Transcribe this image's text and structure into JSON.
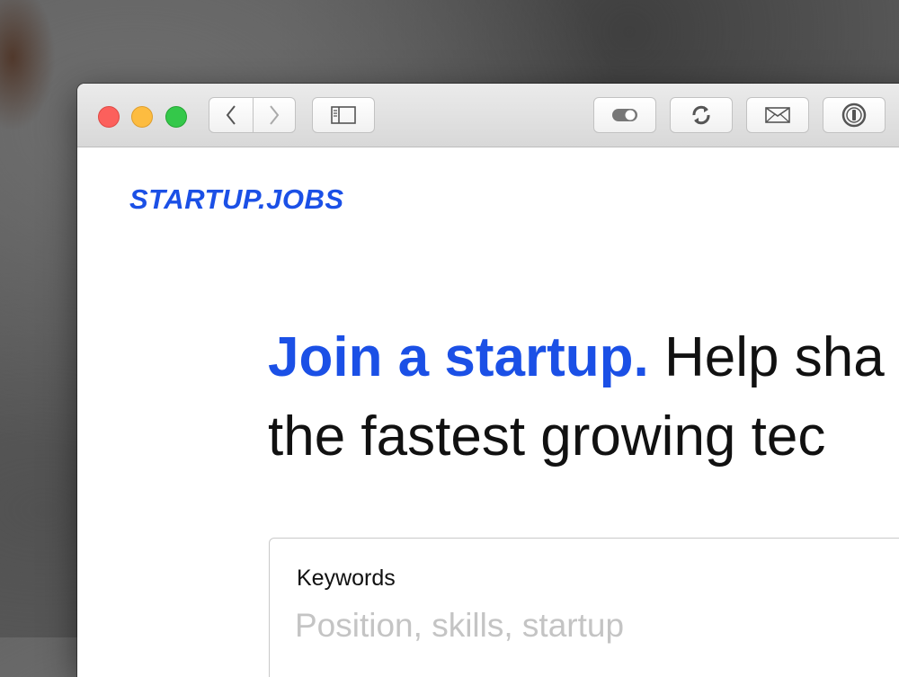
{
  "browser": {
    "traffic_lights": [
      "close",
      "minimize",
      "zoom"
    ],
    "nav": {
      "back_icon": "chevron-left-icon",
      "forward_icon": "chevron-right-icon"
    },
    "sidebar_icon": "sidebar-icon",
    "toolbar_icons": [
      "toggle-icon",
      "refresh-icon",
      "mail-icon",
      "password-icon"
    ]
  },
  "site": {
    "logo": "STARTUP.JOBS",
    "headline_accent": "Join a startup.",
    "headline_rest_line1": " Help sha",
    "headline_line2": "the fastest growing tec",
    "search": {
      "label": "Keywords",
      "placeholder": "Position, skills, startup",
      "value": ""
    }
  },
  "colors": {
    "brand": "#1b50e6",
    "text": "#111111",
    "placeholder": "#c4c4c4"
  }
}
